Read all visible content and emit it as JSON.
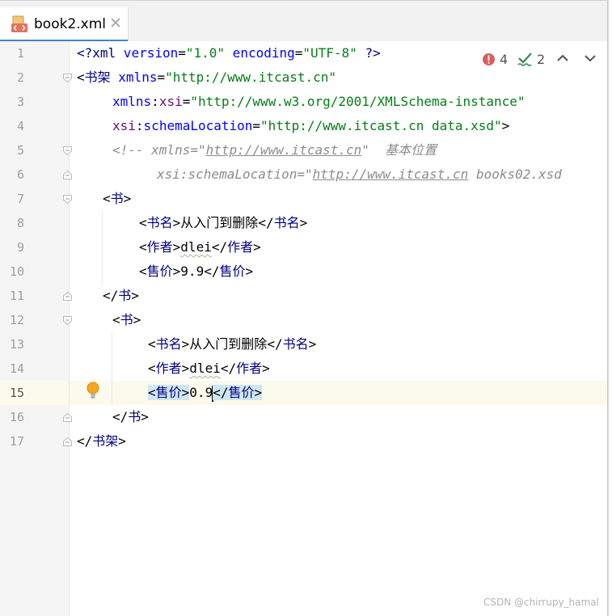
{
  "tab": {
    "title": "book2.xml",
    "close": "✕",
    "icon": "xml-file-icon"
  },
  "inspection": {
    "errors": "4",
    "warnings": "2"
  },
  "line_numbers": [
    "1",
    "2",
    "3",
    "4",
    "5",
    "6",
    "7",
    "8",
    "9",
    "10",
    "11",
    "12",
    "13",
    "14",
    "15",
    "16",
    "17"
  ],
  "code": {
    "l1": {
      "open": "<?",
      "pi": "xml",
      "a1": " version",
      "eq1": "=",
      "v1": "\"1.0\"",
      "a2": " encoding",
      "eq2": "=",
      "v2": "\"UTF-8\"",
      "close": " ?>"
    },
    "l2": {
      "lt": "<",
      "tag": "书架",
      "attr": " xmlns",
      "eq": "=",
      "val": "\"http://www.itcast.cn\""
    },
    "l3": {
      "ns": "xmlns",
      "colon": ":",
      "attr": "xsi",
      "eq": "=",
      "val": "\"http://www.w3.org/2001/XMLSchema-instance\""
    },
    "l4": {
      "ns": "xsi",
      "colon": ":",
      "attr": "schemaLocation",
      "eq": "=",
      "val": "\"http://www.itcast.cn data.xsd\"",
      "gt": ">"
    },
    "l5": {
      "c1": "<!-- xmlns=\"",
      "link": "http://www.itcast.cn",
      "c2": "\"  基本位置"
    },
    "l6": {
      "c1": "xsi:schemaLocation=\"",
      "link": "http://www.itcast.cn",
      "c2": " books02.xsd"
    },
    "l7": {
      "lt": "<",
      "tag": "书",
      "gt": ">"
    },
    "l8": {
      "lt": "<",
      "tag": "书名",
      "gt": ">",
      "text": "从入门到删除",
      "lt2": "</",
      "tag2": "书名",
      "gt2": ">"
    },
    "l9": {
      "lt": "<",
      "tag": "作者",
      "gt": ">",
      "text": "dlei",
      "lt2": "</",
      "tag2": "作者",
      "gt2": ">"
    },
    "l10": {
      "lt": "<",
      "tag": "售价",
      "gt": ">",
      "text": "9.9",
      "lt2": "</",
      "tag2": "售价",
      "gt2": ">"
    },
    "l11": {
      "lt": "</",
      "tag": "书",
      "gt": ">"
    },
    "l12": {
      "lt": "<",
      "tag": "书",
      "gt": ">"
    },
    "l13": {
      "lt": "<",
      "tag": "书名",
      "gt": ">",
      "text": "从入门到删除",
      "lt2": "</",
      "tag2": "书名",
      "gt2": ">"
    },
    "l14": {
      "lt": "<",
      "tag": "作者",
      "gt": ">",
      "text": "dlei",
      "lt2": "</",
      "tag2": "作者",
      "gt2": ">"
    },
    "l15": {
      "lt": "<",
      "tag": "售价",
      "gt": ">",
      "text": "0.9",
      "lt2": "</",
      "tag2": "售价",
      "gt2": ">"
    },
    "l16": {
      "lt": "</",
      "tag": "书",
      "gt": ">"
    },
    "l17": {
      "lt": "</",
      "tag": "书架",
      "gt": ">"
    }
  },
  "watermark": "CSDN @chirrupy_hamal",
  "colors": {
    "tag": "#000080",
    "attribute": "#0000ff",
    "namespace": "#660e7a",
    "string": "#067d17",
    "comment": "#8c8c8c",
    "match_highlight": "#cfe6f5",
    "current_line": "#fcfaed",
    "tab_underline": "#4083c9"
  }
}
